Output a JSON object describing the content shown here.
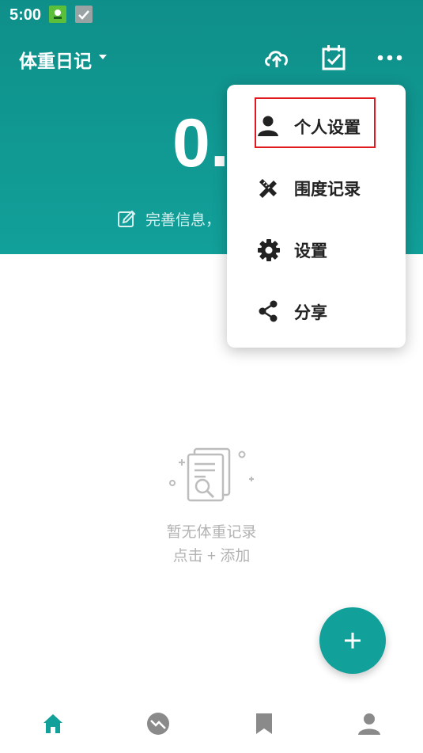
{
  "status_bar": {
    "time": "5:00"
  },
  "app_bar": {
    "title": "体重日记"
  },
  "summary": {
    "weight_visible": "0.",
    "hint": "完善信息，"
  },
  "menu": {
    "items": [
      {
        "label": "个人设置",
        "icon": "person-icon",
        "highlighted": true
      },
      {
        "label": "围度记录",
        "icon": "ruler-pencil-icon",
        "highlighted": false
      },
      {
        "label": "设置",
        "icon": "gear-icon",
        "highlighted": false
      },
      {
        "label": "分享",
        "icon": "share-icon",
        "highlighted": false
      }
    ]
  },
  "empty_state": {
    "line1": "暂无体重记录",
    "line2": "点击 + 添加"
  },
  "bottom_nav": {
    "items": [
      {
        "icon": "home-icon",
        "active": true
      },
      {
        "icon": "trend-icon",
        "active": false
      },
      {
        "icon": "bookmark-icon",
        "active": false
      },
      {
        "icon": "profile-icon",
        "active": false
      }
    ]
  },
  "colors": {
    "primary": "#12a09a",
    "highlight_border": "#e0191f",
    "inactive_icon": "#8a8a8a"
  }
}
